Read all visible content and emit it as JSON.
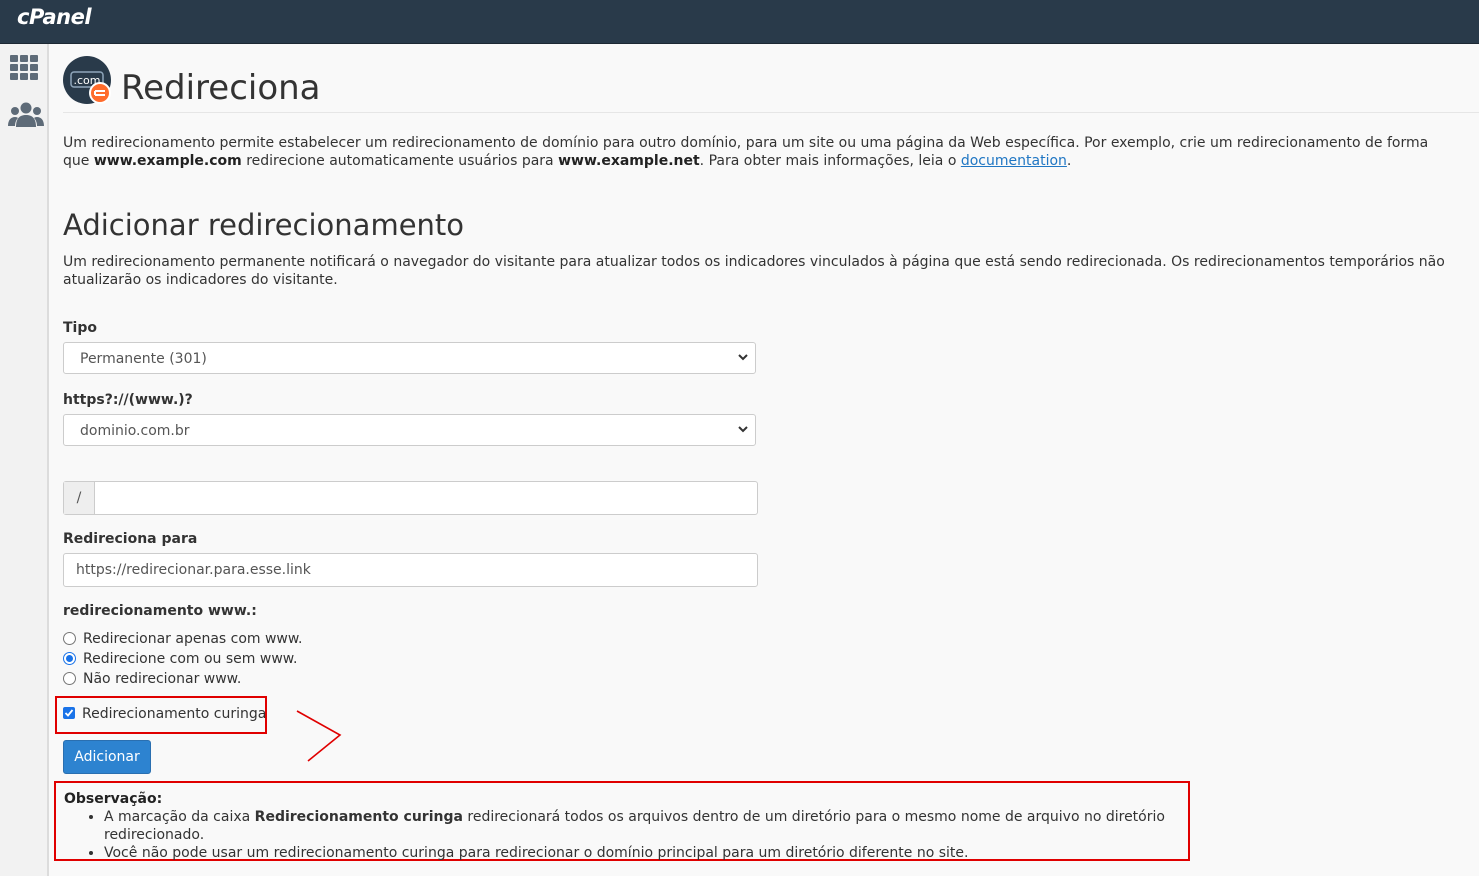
{
  "brand": "cPanel",
  "sidebar": {
    "items": [
      {
        "icon": "grid-icon"
      },
      {
        "icon": "users-icon"
      }
    ]
  },
  "header": {
    "title": "Redireciona",
    "icon_text": ".com"
  },
  "intro": {
    "part1": "Um redirecionamento permite estabelecer um redirecionamento de domínio para outro domínio, para um site ou uma página da Web específica. Por exemplo, crie um redirecionamento de forma que ",
    "example_from": "www.example.com",
    "part2": " redirecione automaticamente usuários para ",
    "example_to": "www.example.net",
    "part3": ". Para obter mais informações, leia o ",
    "link": "documentation",
    "part4": "."
  },
  "section": {
    "title": "Adicionar redirecionamento",
    "description": "Um redirecionamento permanente notificará o navegador do visitante para atualizar todos os indicadores vinculados à página que está sendo redirecionada. Os redirecionamentos temporários não atualizarão os indicadores do visitante."
  },
  "form": {
    "type_label": "Tipo",
    "type_value": "Permanente (301)",
    "domain_label": "https?://(www.)?",
    "domain_value": "dominio.com.br",
    "path_prefix": "/",
    "path_value": "",
    "redirect_label": "Redireciona para",
    "redirect_value": "https://redirecionar.para.esse.link",
    "www_label": "redirecionamento www.:",
    "www_options": [
      {
        "label": "Redirecionar apenas com www.",
        "checked": false
      },
      {
        "label": "Redirecione com ou sem www.",
        "checked": true
      },
      {
        "label": "Não redirecionar www.",
        "checked": false
      }
    ],
    "wildcard_label": "Redirecionamento curinga",
    "wildcard_checked": true,
    "submit_label": "Adicionar"
  },
  "note": {
    "title": "Observação:",
    "item1_pre": "A marcação da caixa ",
    "item1_bold": "Redirecionamento curinga",
    "item1_post": " redirecionará todos os arquivos dentro de um diretório para o mesmo nome de arquivo no diretório redirecionado.",
    "item2": "Você não pode usar um redirecionamento curinga para redirecionar o domínio principal para um diretório diferente no site."
  },
  "colors": {
    "topbar": "#293a4a",
    "primary": "#2d83d0",
    "highlight": "#e00000",
    "link": "#1f76c3"
  }
}
